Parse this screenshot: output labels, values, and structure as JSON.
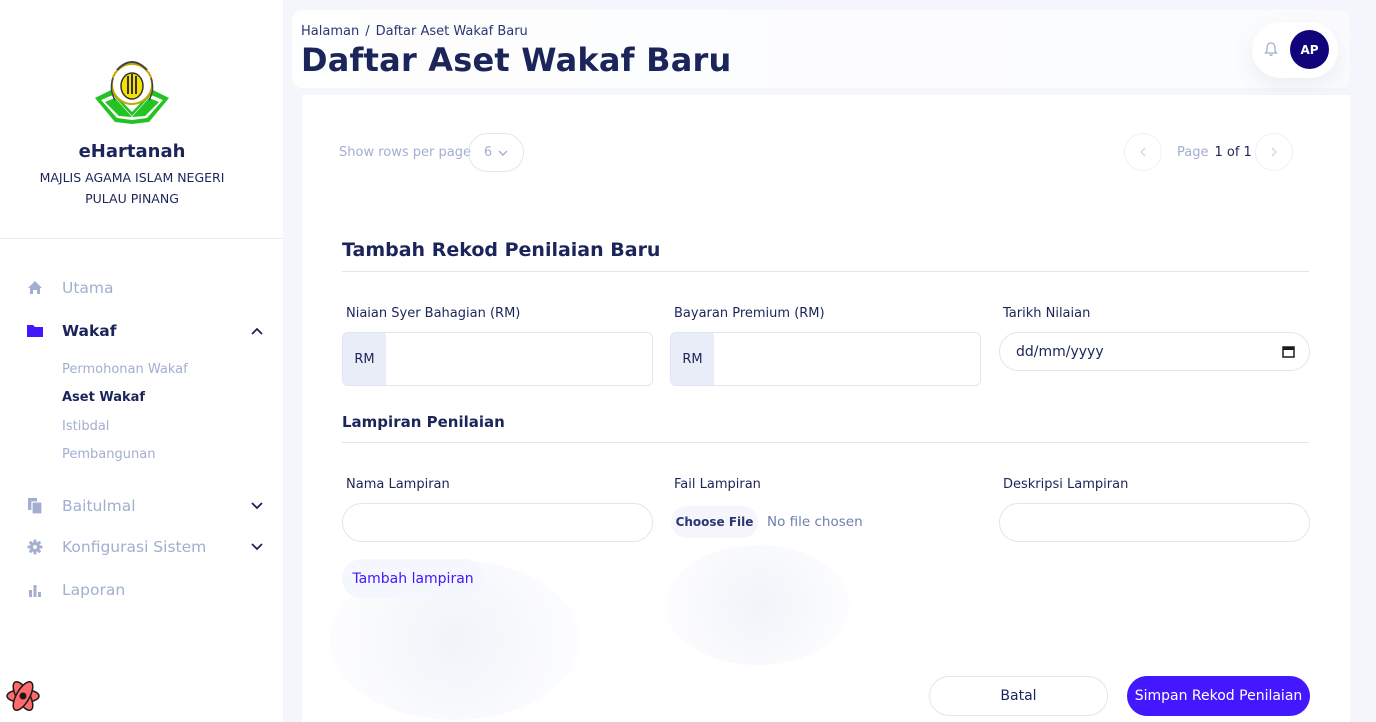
{
  "brand": {
    "title": "eHartanah",
    "subtitle_line1": "MAJLIS AGAMA ISLAM NEGERI",
    "subtitle_line2": "PULAU PINANG"
  },
  "sidebar": {
    "items": [
      {
        "label": "Utama",
        "icon": "home-icon"
      },
      {
        "label": "Wakaf",
        "icon": "folder-icon",
        "active": true,
        "expanded": true
      },
      {
        "label": "Baitulmal",
        "icon": "documents-icon"
      },
      {
        "label": "Konfigurasi Sistem",
        "icon": "gear-icon"
      },
      {
        "label": "Laporan",
        "icon": "bar-chart-icon"
      }
    ],
    "wakaf_sub": [
      {
        "label": "Permohonan Wakaf"
      },
      {
        "label": "Aset Wakaf",
        "active": true
      },
      {
        "label": "Istibdal"
      },
      {
        "label": "Pembangunan"
      }
    ]
  },
  "header": {
    "breadcrumb_root": "Halaman",
    "breadcrumb_sep": "/",
    "breadcrumb_current": "Daftar Aset Wakaf Baru",
    "title": "Daftar Aset Wakaf Baru",
    "avatar_initials": "AP"
  },
  "table_controls": {
    "rows_label": "Show rows per page",
    "rows_value": "6",
    "page_label": "Page",
    "page_value": "1 of 1"
  },
  "form": {
    "section_title": "Tambah Rekod Penilaian Baru",
    "fields": {
      "niaian_label": "Niaian Syer Bahagian (RM)",
      "niaian_addon": "RM",
      "bayaran_label": "Bayaran Premium (RM)",
      "bayaran_addon": "RM",
      "tarikh_label": "Tarikh Nilaian",
      "tarikh_placeholder": "dd/mm/yyyy"
    },
    "lampiran_title": "Lampiran Penilaian",
    "lampiran": {
      "nama_label": "Nama Lampiran",
      "fail_label": "Fail Lampiran",
      "choose_file": "Choose File",
      "no_file": "No file chosen",
      "deskripsi_label": "Deskripsi Lampiran"
    },
    "add_button": "Tambah lampiran",
    "cancel_button": "Batal",
    "save_button": "Simpan Rekod Penilaian"
  },
  "colors": {
    "primary": "#4318ff",
    "navy": "#1b2559",
    "muted": "#a3aed0",
    "avatar": "#11047a"
  }
}
